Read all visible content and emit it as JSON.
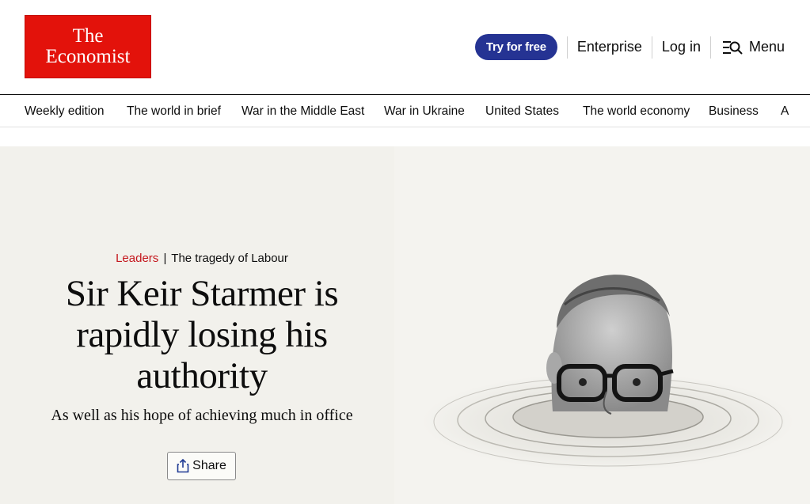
{
  "logo": {
    "line1": "The",
    "line2": "Economist"
  },
  "header": {
    "try_label": "Try for free",
    "enterprise_label": "Enterprise",
    "login_label": "Log in",
    "menu_label": "Menu"
  },
  "nav": {
    "items": [
      {
        "label": "Weekly edition"
      },
      {
        "label": "The world in brief"
      },
      {
        "label": "War in the Middle East"
      },
      {
        "label": "War in Ukraine"
      },
      {
        "label": "United States"
      },
      {
        "label": "The world economy"
      },
      {
        "label": "Business"
      },
      {
        "label": "A"
      }
    ]
  },
  "article": {
    "section": "Leaders",
    "separator": "|",
    "rubric": "The tragedy of Labour",
    "headline": "Sir Keir Starmer is rapidly losing his authority",
    "subheadline": "As well as his hope of achieving much in office",
    "share_label": "Share"
  },
  "colors": {
    "brand_red": "#e3120b",
    "button_navy": "#253393",
    "section_red": "#c4161c",
    "hero_bg": "#f2f1ec"
  },
  "icons": [
    "menu-search-icon",
    "share-icon",
    "portrait-illustration"
  ]
}
